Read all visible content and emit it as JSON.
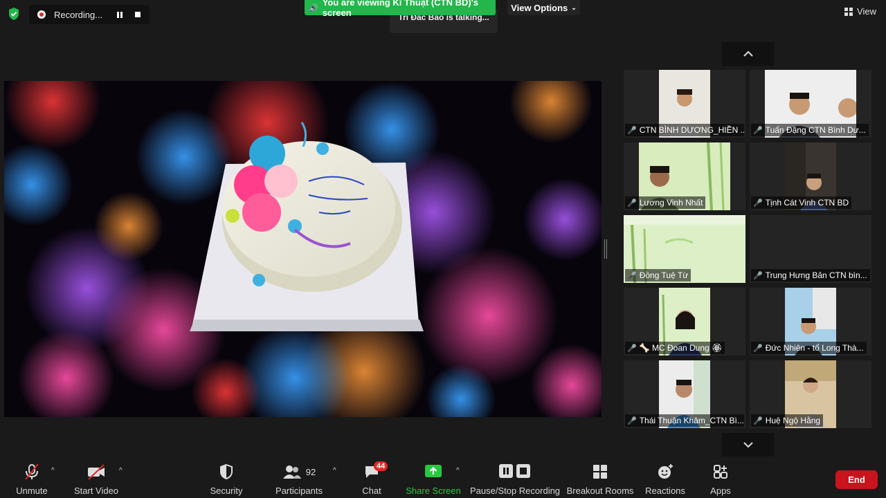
{
  "top": {
    "recording_label": "Recording...",
    "viewing_banner": "You are viewing Kĩ Thuật (CTN BD)'s screen",
    "view_options_label": "View Options",
    "talking_indicator": "Trí Đắc Bảo is talking...",
    "view_label": "View"
  },
  "gallery": {
    "tiles": [
      {
        "name": "CTN BÌNH DƯƠNG_HIỀN ..."
      },
      {
        "name": "Tuấn Đặng CTN Bình Dư..."
      },
      {
        "name": "Lương Vinh Nhất"
      },
      {
        "name": "Tịnh Cát Vinh CTN BD"
      },
      {
        "name": "Đồng Tuệ Từ"
      },
      {
        "name": "Trung Hưng Bản CTN bìn..."
      },
      {
        "name": "🦴 MC Đoan Dung 🏵"
      },
      {
        "name": "Đức Nhiên - tổ Long Thà..."
      },
      {
        "name": "Thái Thuận Khâm_CTN Bì..."
      },
      {
        "name": "Huệ Ngộ Hằng"
      }
    ]
  },
  "toolbar": {
    "unmute": "Unmute",
    "start_video": "Start Video",
    "security": "Security",
    "participants": "Participants",
    "participants_count": "92",
    "chat": "Chat",
    "chat_badge": "44",
    "share_screen": "Share Screen",
    "recording": "Pause/Stop Recording",
    "breakout": "Breakout Rooms",
    "reactions": "Reactions",
    "apps": "Apps",
    "end": "End"
  },
  "colors": {
    "banner_green": "#23b64a",
    "end_red": "#c9141e",
    "muted_red": "#e02828",
    "share_green": "#28c840"
  }
}
